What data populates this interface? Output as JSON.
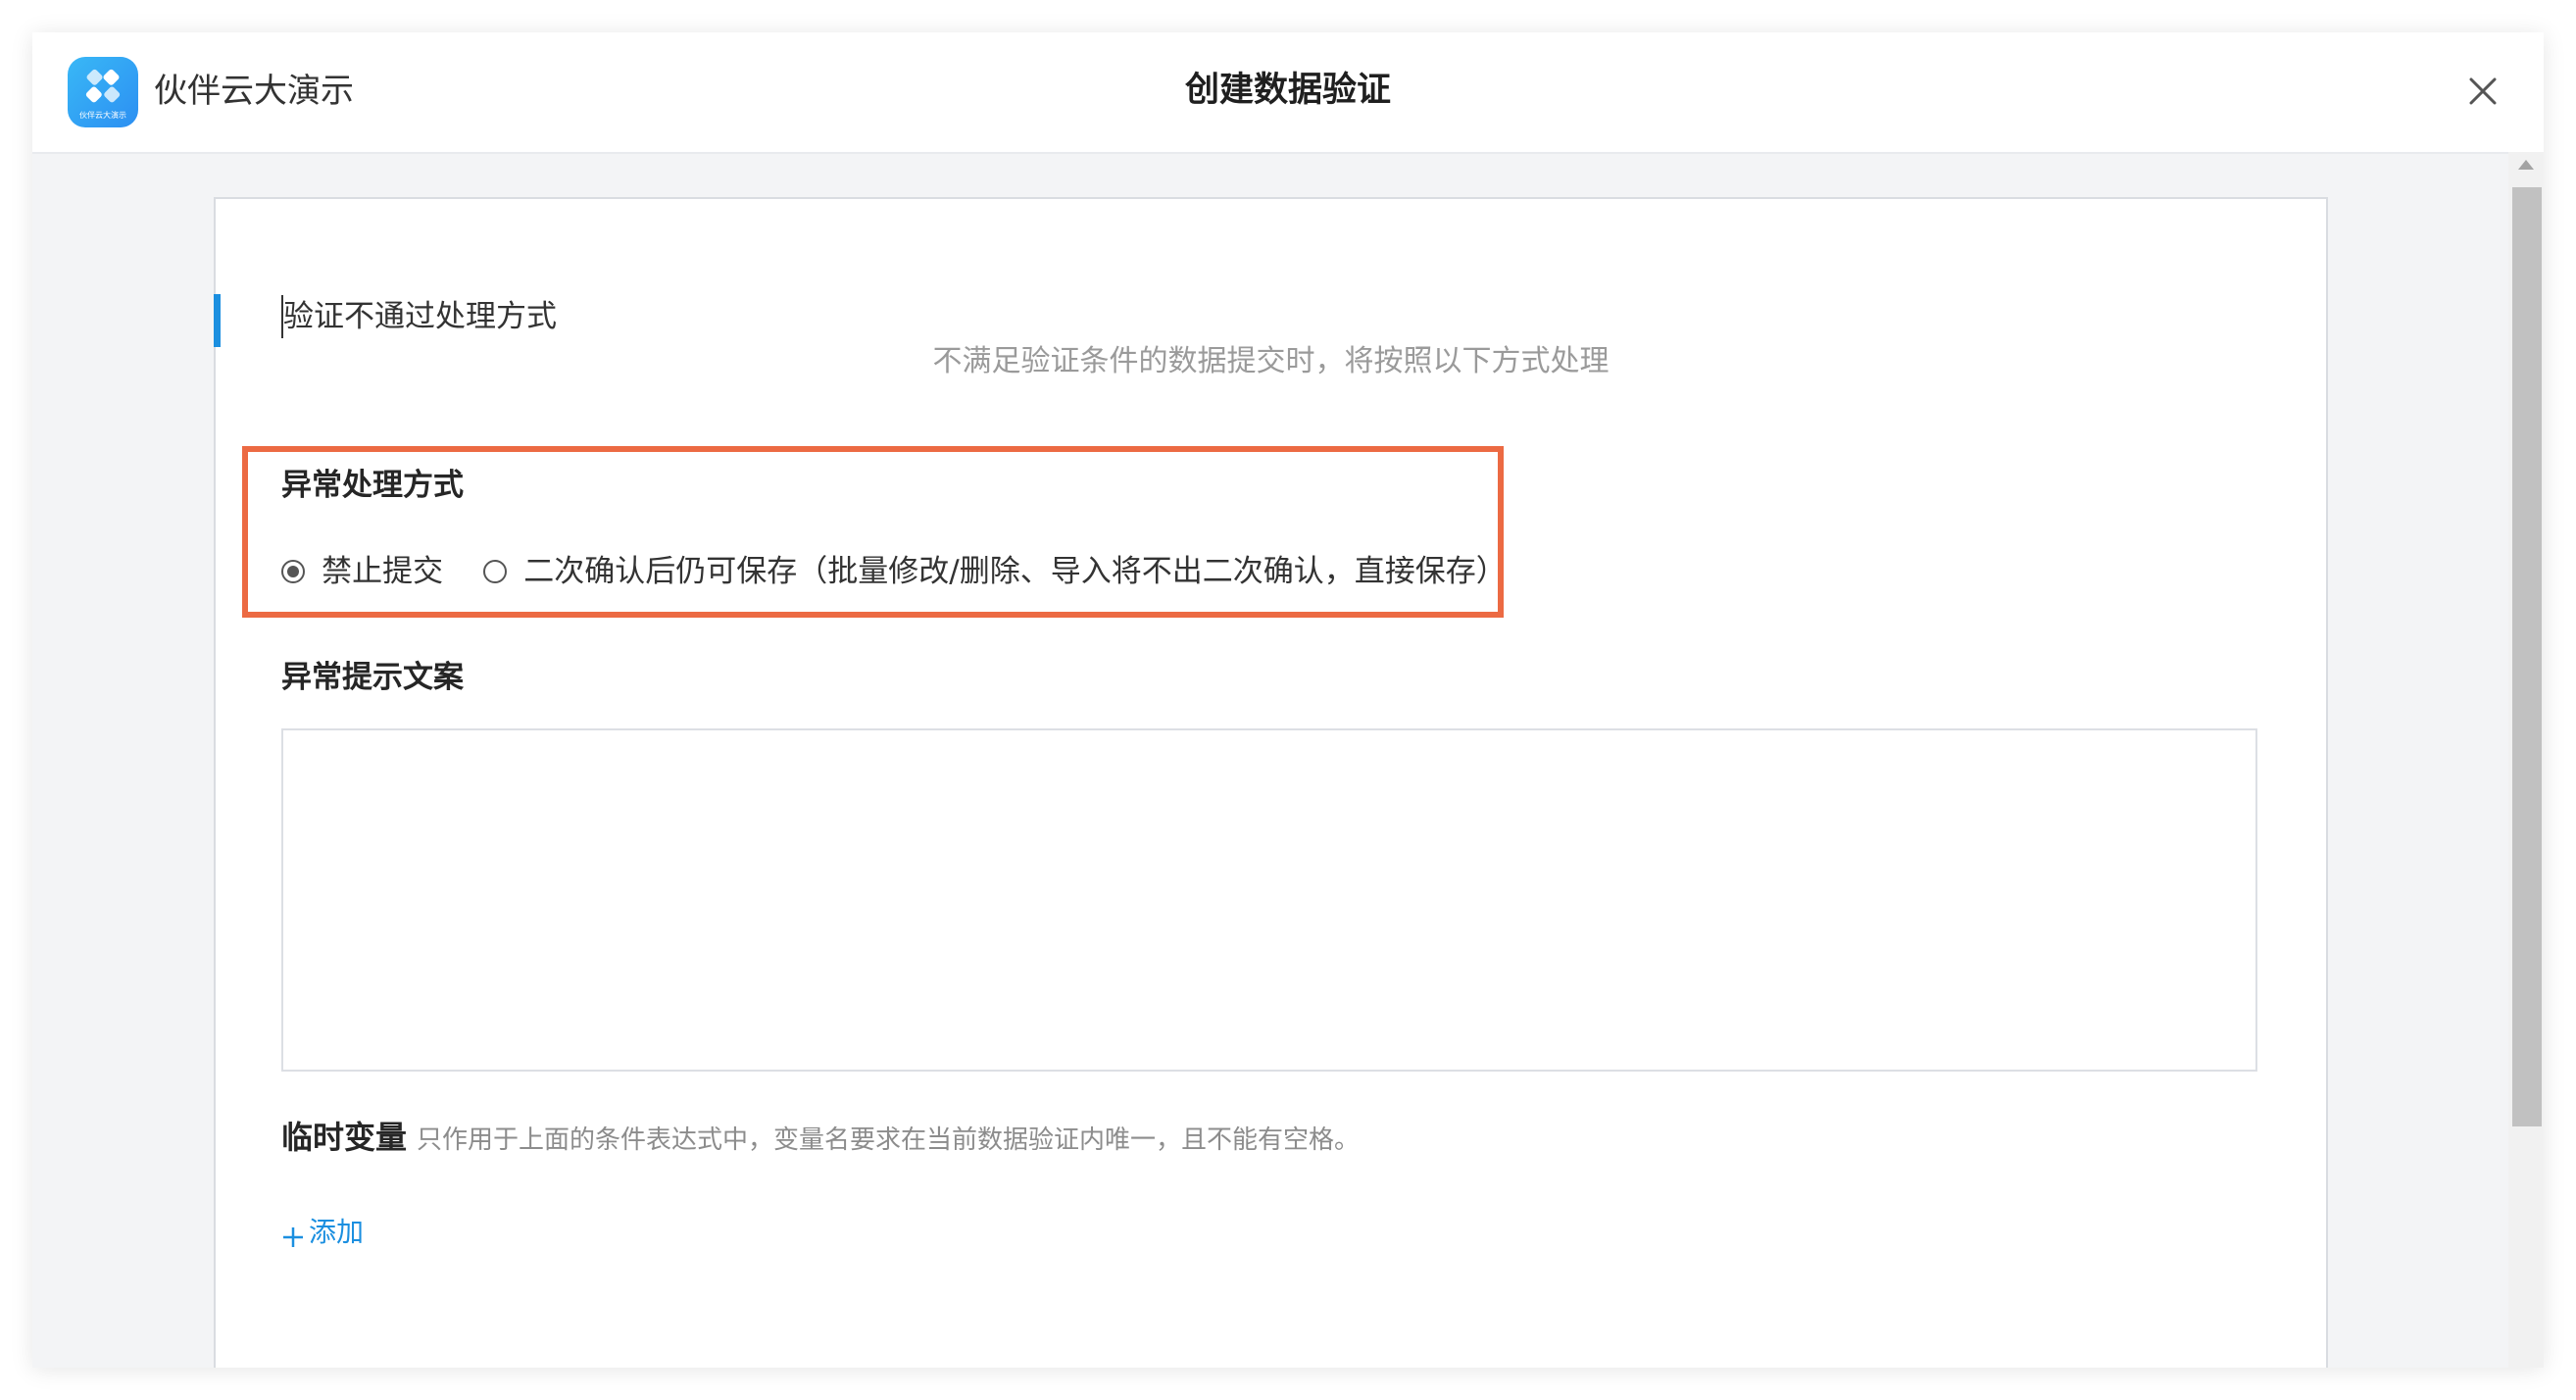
{
  "app": {
    "name": "伙伴云大演示",
    "logo_text": "伙伴云大演示",
    "brand_color": "#2c8ff2"
  },
  "dialog": {
    "title": "创建数据验证",
    "close_icon": "close-icon"
  },
  "section": {
    "title": "验证不通过处理方式",
    "description": "不满足验证条件的数据提交时，将按照以下方式处理"
  },
  "exception_handling": {
    "label": "异常处理方式",
    "options": [
      {
        "label": "禁止提交",
        "selected": true
      },
      {
        "label": "二次确认后仍可保存（批量修改/删除、导入将不出二次确认，直接保存）",
        "selected": false
      }
    ],
    "highlight_color": "#ec6a43"
  },
  "exception_message": {
    "label": "异常提示文案",
    "value": ""
  },
  "temp_variables": {
    "label": "临时变量",
    "hint": "只作用于上面的条件表达式中，变量名要求在当前数据验证内唯一，且不能有空格。",
    "add_icon": "plus-icon",
    "add_label": "添加"
  }
}
